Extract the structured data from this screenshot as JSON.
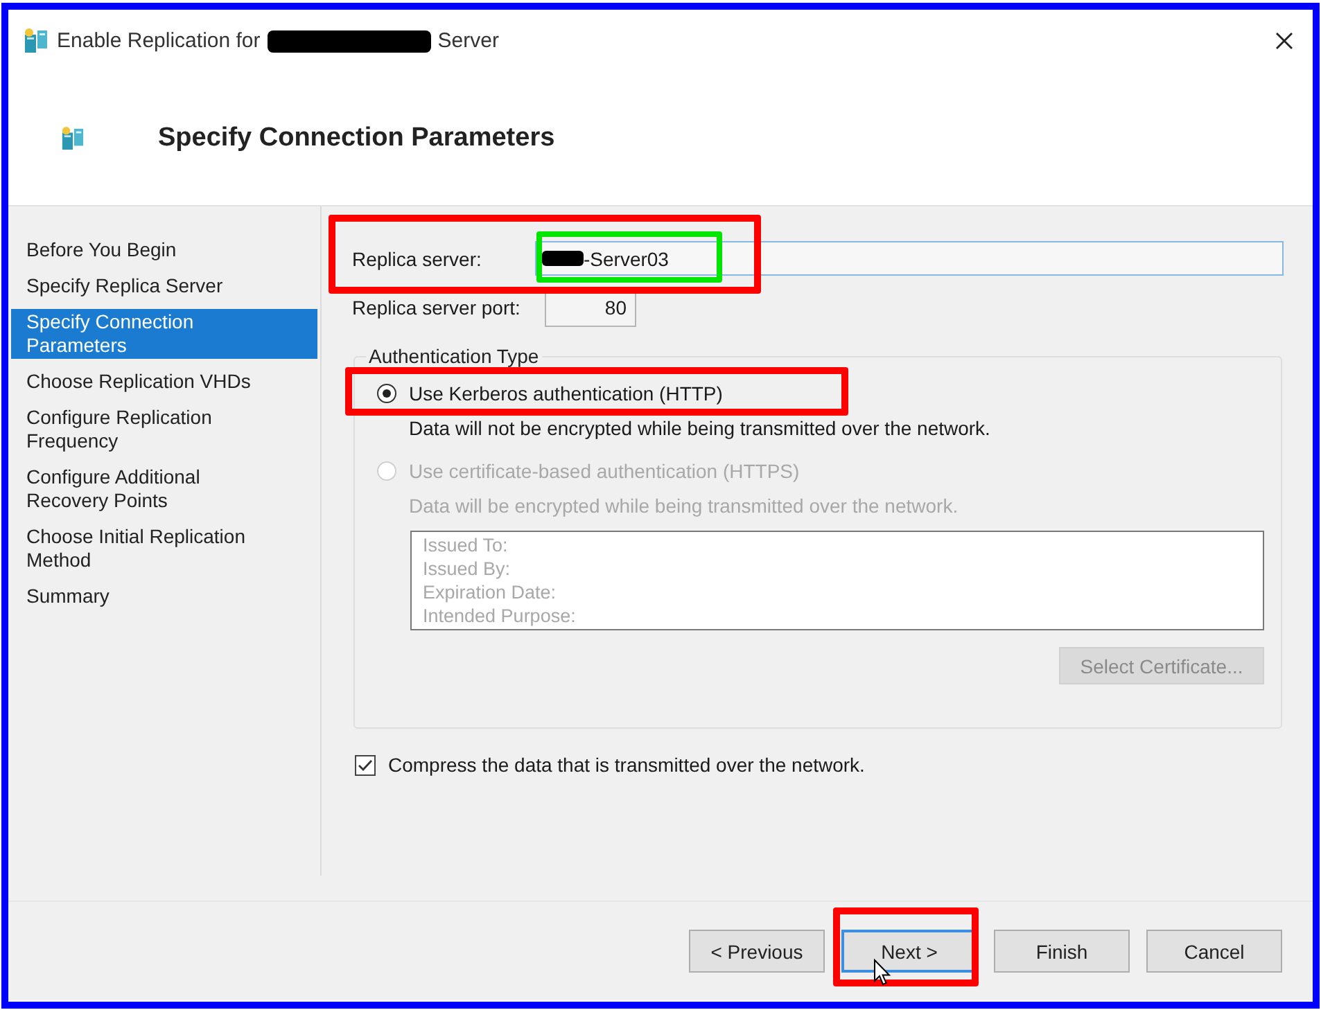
{
  "window": {
    "title": "Enable Replication for",
    "title_redacted": true,
    "title_end": "Server"
  },
  "header": {
    "title": "Specify Connection Parameters"
  },
  "steps": [
    {
      "label": "Before You Begin",
      "selected": false
    },
    {
      "label": "Specify Replica Server",
      "selected": false
    },
    {
      "label": "Specify Connection Parameters",
      "selected": true
    },
    {
      "label": "Choose Replication VHDs",
      "selected": false
    },
    {
      "label": "Configure Replication Frequency",
      "selected": false
    },
    {
      "label": "Configure Additional Recovery Points",
      "selected": false
    },
    {
      "label": "Choose Initial Replication Method",
      "selected": false
    },
    {
      "label": "Summary",
      "selected": false
    }
  ],
  "replica_server": {
    "label": "Replica server:",
    "value": "-Server03",
    "redacted": true
  },
  "replica_server_port": {
    "label": "Replica server port:",
    "value": "80"
  },
  "authentication": {
    "title": "Authentication Type",
    "options": [
      {
        "label": "Use Kerberos authentication (HTTP)",
        "description": "Data will not be encrypted while being transmitted over the network.",
        "selected": true,
        "disabled": false
      },
      {
        "label": "Use certificate-based authentication (HTTPS)",
        "description": "Data will be encrypted while being transmitted over the network.",
        "selected": false,
        "disabled": true
      }
    ],
    "certificate_fields": [
      "Issued To:",
      "Issued By:",
      "Expiration Date:",
      "Intended Purpose:"
    ],
    "select_button": {
      "label": "Select Certificate...",
      "disabled": true
    }
  },
  "compress": {
    "label": "Compress the data that is transmitted over the network.",
    "checked": true
  },
  "buttons": [
    {
      "label": "< Previous",
      "focused": false
    },
    {
      "label": "Next >",
      "focused": true
    },
    {
      "label": "Finish",
      "focused": false
    },
    {
      "label": "Cancel",
      "focused": false
    }
  ],
  "annotations": [
    {
      "kind": "frame",
      "color": "#0000ff"
    },
    {
      "kind": "server-row",
      "color": "#ff0000"
    },
    {
      "kind": "server-value",
      "color": "#00e600"
    },
    {
      "kind": "kerberos-option",
      "color": "#ff0000"
    },
    {
      "kind": "next-button",
      "color": "#ff0000"
    }
  ]
}
